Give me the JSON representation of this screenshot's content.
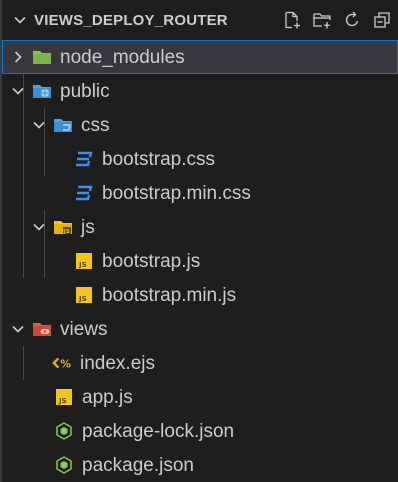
{
  "explorer": {
    "title": "VIEWS_DEPLOY_ROUTER",
    "actions": [
      "new-file-icon",
      "new-folder-icon",
      "refresh-icon",
      "collapse-all-icon"
    ]
  },
  "tree": [
    {
      "name": "node_modules",
      "kind": "folder",
      "icon": "folder-green-icon",
      "expanded": false,
      "selected": true
    },
    {
      "name": "public",
      "kind": "folder",
      "icon": "folder-public-icon",
      "expanded": true
    },
    {
      "name": "css",
      "kind": "folder",
      "icon": "folder-css-icon",
      "expanded": true
    },
    {
      "name": "bootstrap.css",
      "kind": "file",
      "icon": "css-file-icon"
    },
    {
      "name": "bootstrap.min.css",
      "kind": "file",
      "icon": "css-file-icon"
    },
    {
      "name": "js",
      "kind": "folder",
      "icon": "folder-js-icon",
      "expanded": true
    },
    {
      "name": "bootstrap.js",
      "kind": "file",
      "icon": "js-file-icon"
    },
    {
      "name": "bootstrap.min.js",
      "kind": "file",
      "icon": "js-file-icon"
    },
    {
      "name": "views",
      "kind": "folder",
      "icon": "folder-views-icon",
      "expanded": true
    },
    {
      "name": "index.ejs",
      "kind": "file",
      "icon": "ejs-file-icon"
    },
    {
      "name": "app.js",
      "kind": "file",
      "icon": "js-file-icon"
    },
    {
      "name": "package-lock.json",
      "kind": "file",
      "icon": "node-file-icon"
    },
    {
      "name": "package.json",
      "kind": "file",
      "icon": "node-file-icon"
    }
  ],
  "colors": {
    "background": "#1e1e1e",
    "text": "#cccccc",
    "selection": "#37373d",
    "css": "#3b8eea",
    "js": "#f5c518",
    "ejs": "#e8b100",
    "node": "#8cc84b",
    "folder_green": "#8bc34a",
    "folder_blue": "#4aa3e8",
    "folder_red": "#e35b4a"
  }
}
